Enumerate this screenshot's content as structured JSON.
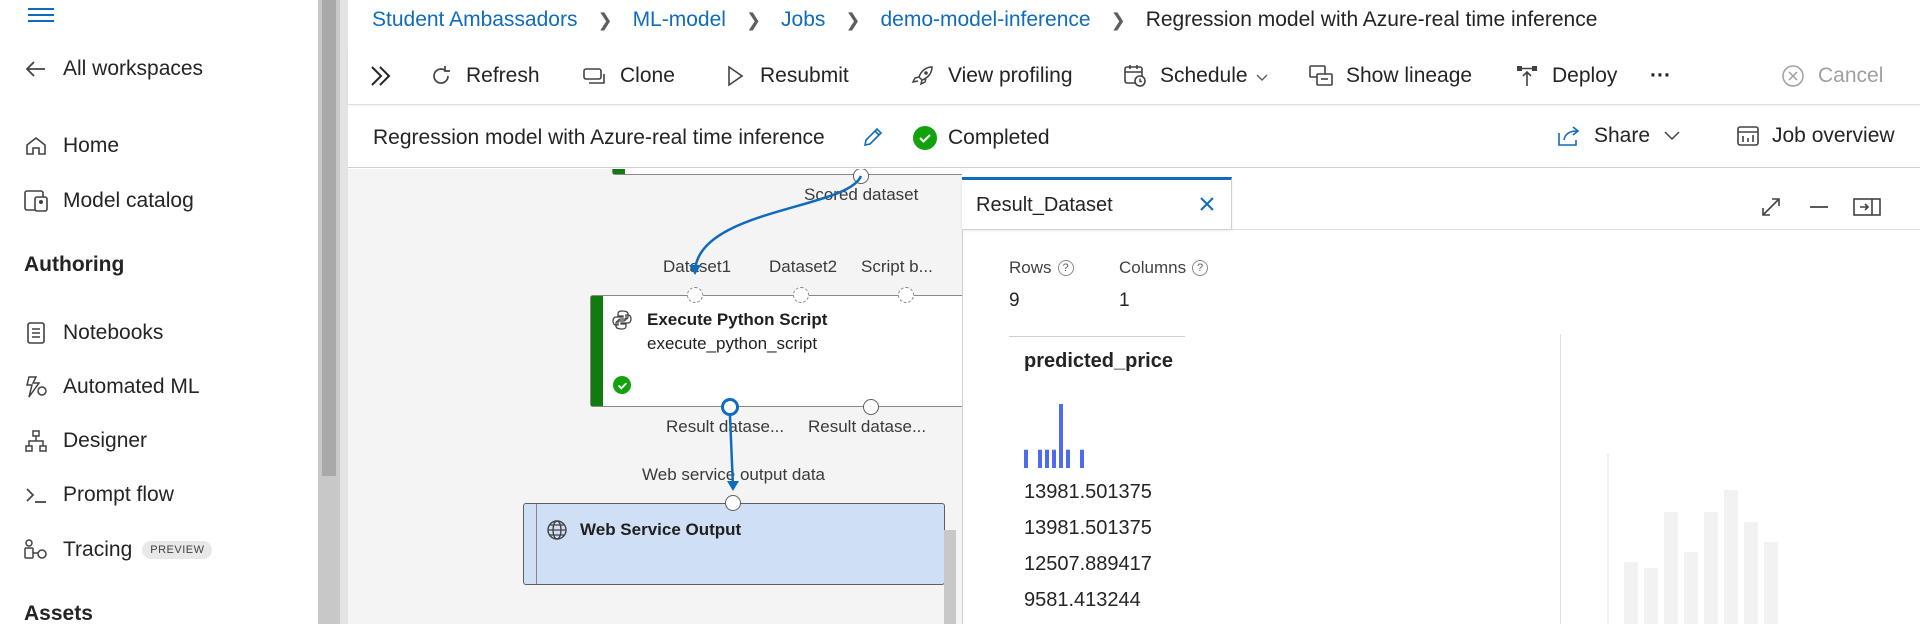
{
  "sidebar": {
    "back_label": "All workspaces",
    "items": [
      {
        "label": "Home",
        "icon": "home-icon"
      },
      {
        "label": "Model catalog",
        "icon": "catalog-icon"
      }
    ],
    "authoring_header": "Authoring",
    "authoring_items": [
      {
        "label": "Notebooks",
        "icon": "notebook-icon"
      },
      {
        "label": "Automated ML",
        "icon": "automl-icon"
      },
      {
        "label": "Designer",
        "icon": "designer-icon"
      },
      {
        "label": "Prompt flow",
        "icon": "prompt-flow-icon"
      },
      {
        "label": "Tracing",
        "icon": "tracing-icon",
        "badge": "PREVIEW"
      }
    ],
    "assets_header": "Assets"
  },
  "breadcrumb": {
    "items": [
      "Student Ambassadors",
      "ML-model",
      "Jobs",
      "demo-model-inference"
    ],
    "current": "Regression model with Azure-real time inference"
  },
  "toolbar": {
    "refresh": "Refresh",
    "clone": "Clone",
    "resubmit": "Resubmit",
    "view_profiling": "View profiling",
    "schedule": "Schedule",
    "show_lineage": "Show lineage",
    "deploy": "Deploy",
    "more": "···",
    "cancel": "Cancel"
  },
  "job": {
    "title": "Regression model with Azure-real time inference",
    "status": "Completed",
    "share": "Share",
    "overview": "Job overview"
  },
  "canvas": {
    "scored_dataset": "Scored dataset",
    "inputs": [
      "Dataset1",
      "Dataset2",
      "Script b..."
    ],
    "python_node": {
      "title": "Execute Python Script",
      "subtitle": "execute_python_script"
    },
    "outputs": [
      "Result datase...",
      "Result datase..."
    ],
    "web_output_label": "Web service output data",
    "web_node_title": "Web Service Output"
  },
  "panel": {
    "tab_title": "Result_Dataset",
    "rows_label": "Rows",
    "rows_value": "9",
    "columns_label": "Columns",
    "columns_value": "1",
    "column_name": "predicted_price",
    "histogram": [
      1,
      0,
      1,
      1,
      1,
      3.5,
      1,
      0,
      1
    ],
    "values": [
      "13981.501375",
      "13981.501375",
      "12507.889417",
      "9581.413244"
    ]
  },
  "colors": {
    "accent": "#0f6cbd",
    "success": "#13a10e",
    "module_bar": "#107c10",
    "web_node": "#cfe0f6"
  }
}
